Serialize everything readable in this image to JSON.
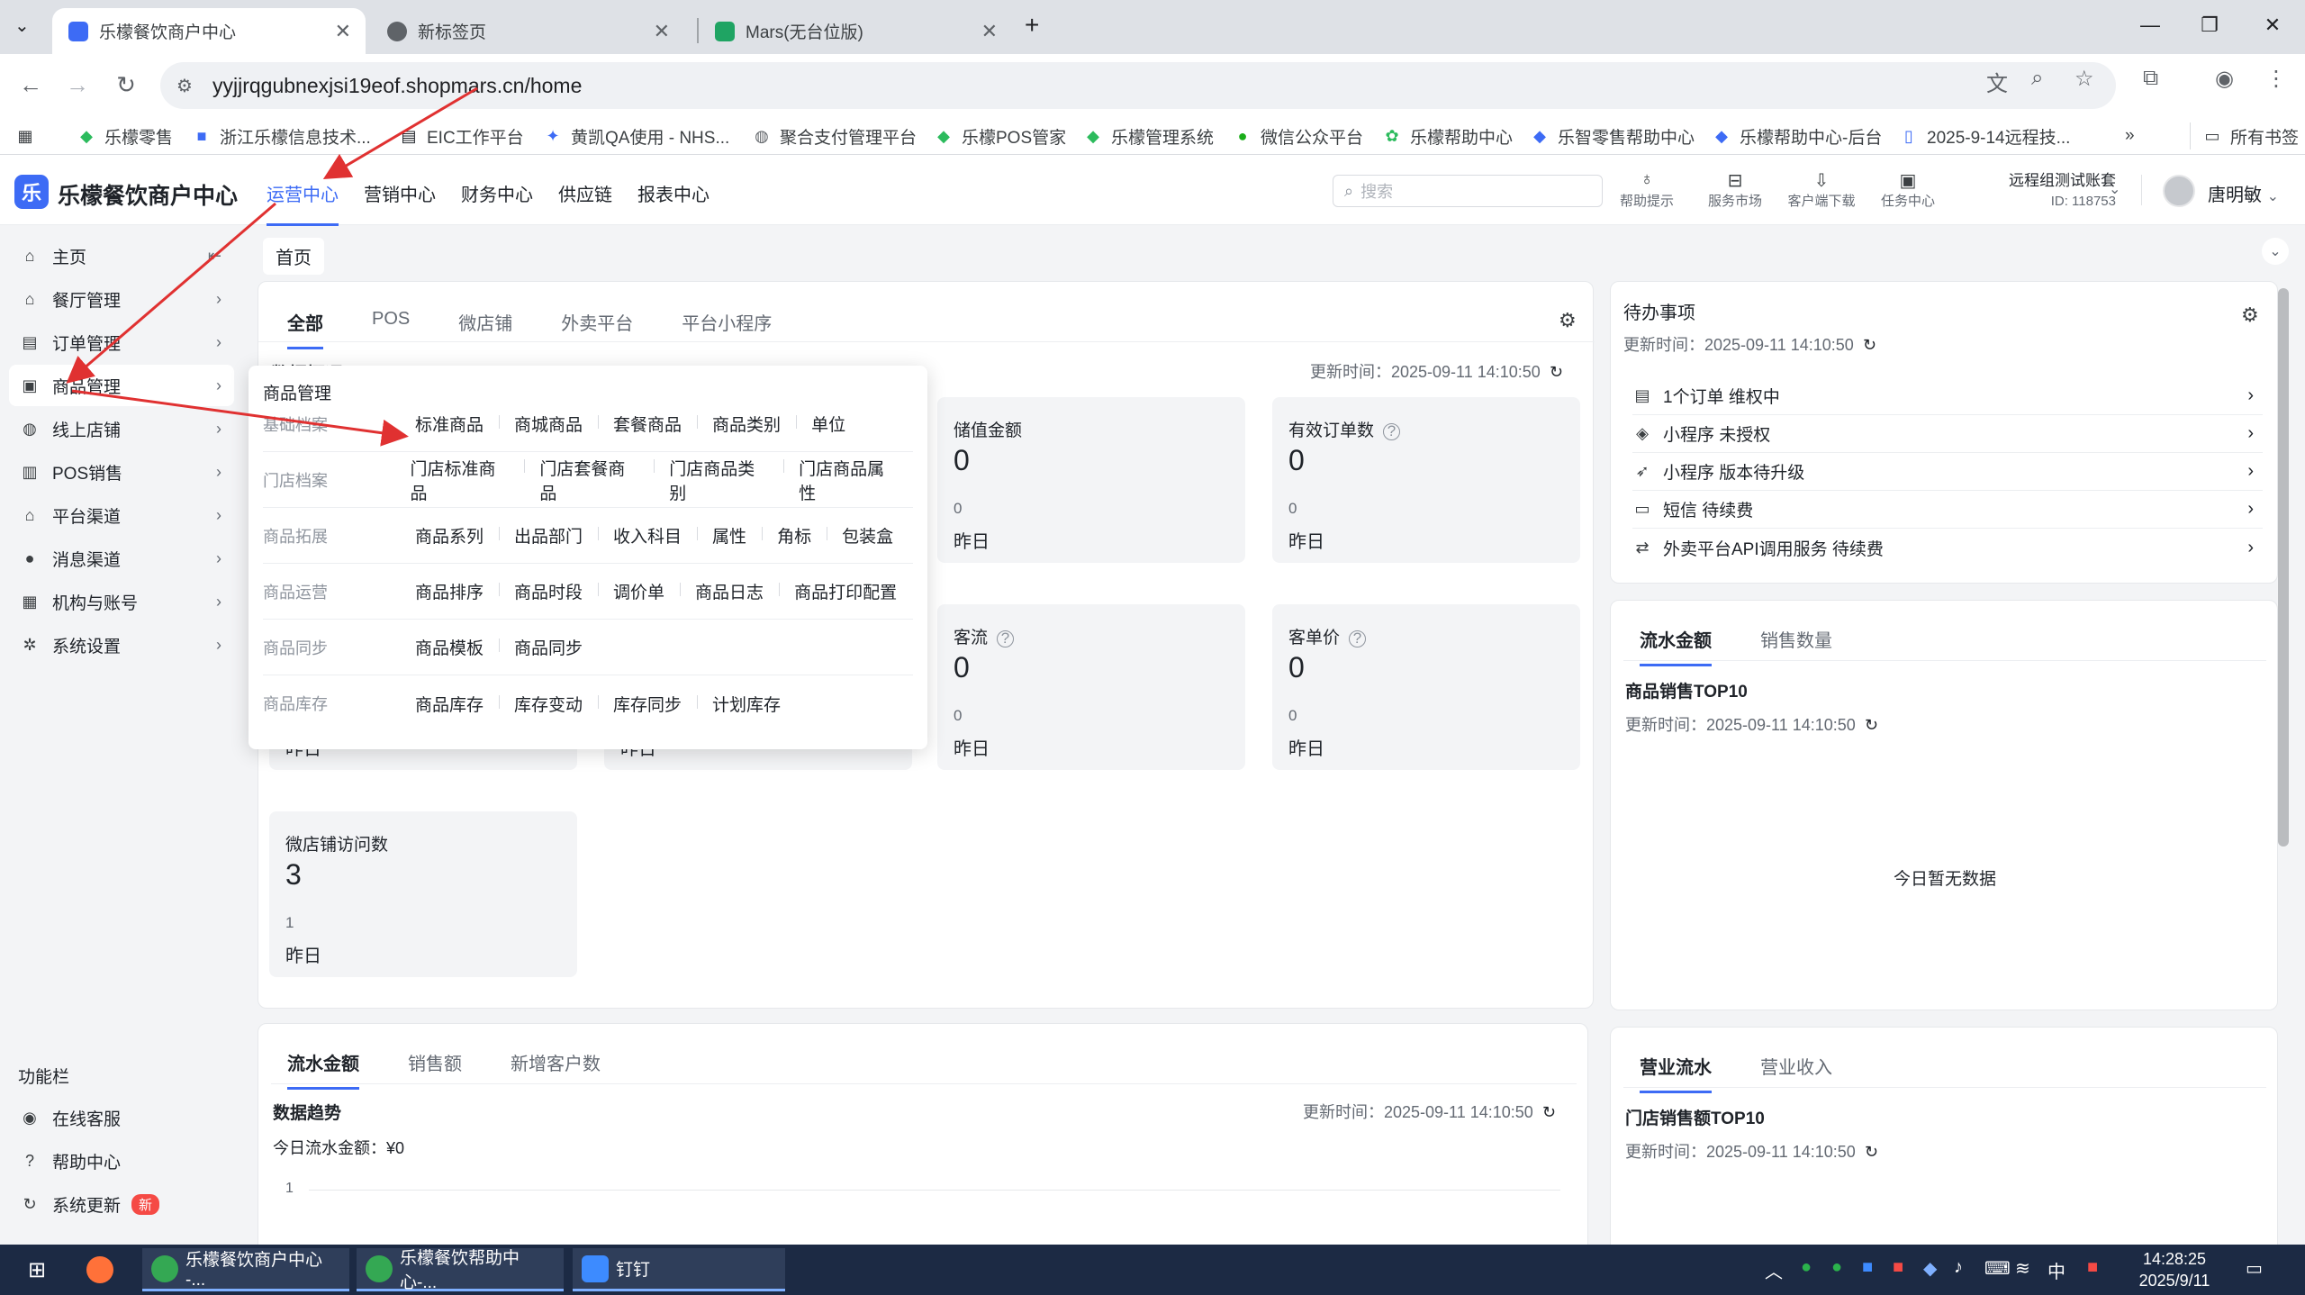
{
  "browser": {
    "tabs": [
      {
        "title": "乐檬餐饮商户中心",
        "active": true
      },
      {
        "title": "新标签页",
        "active": false
      },
      {
        "title": "Mars(无台位版)",
        "active": false
      }
    ],
    "new_tab": "+",
    "url": "yyjjrqgubnexjsi19eof.shopmars.cn/home",
    "bookmarks": [
      "乐檬零售",
      "浙江乐檬信息技术...",
      "EIC工作平台",
      "黄凯QA使用 - NHS...",
      "聚合支付管理平台",
      "乐檬POS管家",
      "乐檬管理系统",
      "微信公众平台",
      "乐檬帮助中心",
      "乐智零售帮助中心",
      "乐檬帮助中心-后台",
      "2025-9-14远程技..."
    ],
    "more_bookmarks": "»",
    "all_bookmarks": "所有书签"
  },
  "app": {
    "logo_text": "乐",
    "brand": "乐檬餐饮商户中心",
    "top_nav": [
      "运营中心",
      "营销中心",
      "财务中心",
      "供应链",
      "报表中心"
    ],
    "search_placeholder": "搜索",
    "tools": [
      "帮助提示",
      "服务市场",
      "客户端下载",
      "任务中心"
    ],
    "account_name": "远程组测试账套",
    "account_id": "ID: 118753",
    "user": "唐明敏"
  },
  "sidebar": {
    "items": [
      {
        "label": "主页",
        "icon": "home-icon"
      },
      {
        "label": "餐厅管理",
        "icon": "store-icon"
      },
      {
        "label": "订单管理",
        "icon": "order-icon"
      },
      {
        "label": "商品管理",
        "icon": "goods-icon"
      },
      {
        "label": "线上店铺",
        "icon": "globe-icon"
      },
      {
        "label": "POS销售",
        "icon": "pos-icon"
      },
      {
        "label": "平台渠道",
        "icon": "bank-icon"
      },
      {
        "label": "消息渠道",
        "icon": "message-icon"
      },
      {
        "label": "机构与账号",
        "icon": "org-icon"
      },
      {
        "label": "系统设置",
        "icon": "gear-icon"
      }
    ],
    "function_title": "功能栏",
    "functions": [
      {
        "label": "在线客服",
        "icon": "support-icon"
      },
      {
        "label": "帮助中心",
        "icon": "help-icon"
      },
      {
        "label": "系统更新",
        "icon": "refresh-icon",
        "badge": "新"
      }
    ]
  },
  "page": {
    "breadcrumb": "首页",
    "channel_tabs": [
      "全部",
      "POS",
      "微店铺",
      "外卖平台",
      "平台小程序"
    ],
    "overview_title": "数据概况",
    "updated": "更新时间：2025-09-11 14:10:50",
    "stats": [
      {
        "label": "储值金额",
        "value": "0",
        "sub": "0",
        "day": "昨日",
        "help": false
      },
      {
        "label": "有效订单数",
        "value": "0",
        "sub": "0",
        "day": "昨日",
        "help": true
      },
      {
        "label": "客流",
        "value": "0",
        "sub": "0",
        "day": "昨日",
        "help": true
      },
      {
        "label": "客单价",
        "value": "0",
        "sub": "0",
        "day": "昨日",
        "help": true
      },
      {
        "label": "微店铺访问数",
        "value": "3",
        "sub": "1",
        "day": "昨日",
        "help": false
      }
    ],
    "hidden_days": [
      "昨日",
      "昨日"
    ],
    "todo": {
      "title": "待办事项",
      "updated": "更新时间：2025-09-11 14:10:50",
      "items": [
        {
          "label": "1个订单 维权中",
          "icon": "list-icon"
        },
        {
          "label": "小程序 未授权",
          "icon": "miniapp-icon"
        },
        {
          "label": "小程序 版本待升级",
          "icon": "rocket-icon"
        },
        {
          "label": "短信 待续费",
          "icon": "sms-icon"
        },
        {
          "label": "外卖平台API调用服务 待续费",
          "icon": "api-icon"
        }
      ]
    },
    "top10": {
      "tabs": [
        "流水金额",
        "销售数量"
      ],
      "title": "商品销售TOP10",
      "updated": "更新时间：2025-09-11 14:10:50",
      "empty": "今日暂无数据"
    },
    "trend": {
      "tabs": [
        "流水金额",
        "销售额",
        "新增客户数"
      ],
      "title": "数据趋势",
      "updated": "更新时间：2025-09-11 14:10:50",
      "today": "今日流水金额：¥0",
      "y_tick": "1"
    },
    "store_top10": {
      "tabs": [
        "营业流水",
        "营业收入"
      ],
      "title": "门店销售额TOP10",
      "updated": "更新时间：2025-09-11 14:10:50"
    }
  },
  "flyout": {
    "title": "商品管理",
    "rows": [
      {
        "label": "基础档案",
        "items": [
          "标准商品",
          "商城商品",
          "套餐商品",
          "商品类别",
          "单位"
        ]
      },
      {
        "label": "门店档案",
        "items": [
          "门店标准商品",
          "门店套餐商品",
          "门店商品类别",
          "门店商品属性"
        ]
      },
      {
        "label": "商品拓展",
        "items": [
          "商品系列",
          "出品部门",
          "收入科目",
          "属性",
          "角标",
          "包装盒"
        ]
      },
      {
        "label": "商品运营",
        "items": [
          "商品排序",
          "商品时段",
          "调价单",
          "商品日志",
          "商品打印配置"
        ]
      },
      {
        "label": "商品同步",
        "items": [
          "商品模板",
          "商品同步"
        ]
      },
      {
        "label": "商品库存",
        "items": [
          "商品库存",
          "库存变动",
          "库存同步",
          "计划库存"
        ]
      }
    ]
  },
  "taskbar": {
    "apps": [
      {
        "label": "乐檬餐饮商户中心 -...",
        "open": true
      },
      {
        "label": "乐檬餐饮帮助中心-...",
        "open": true
      },
      {
        "label": "钉钉",
        "open": true
      }
    ],
    "ime": "中",
    "time": "14:28:25",
    "date": "2025/9/11"
  },
  "colors": {
    "accent": "#3d6bf5",
    "annotation": "#e03131",
    "badge": "#f54a45"
  }
}
